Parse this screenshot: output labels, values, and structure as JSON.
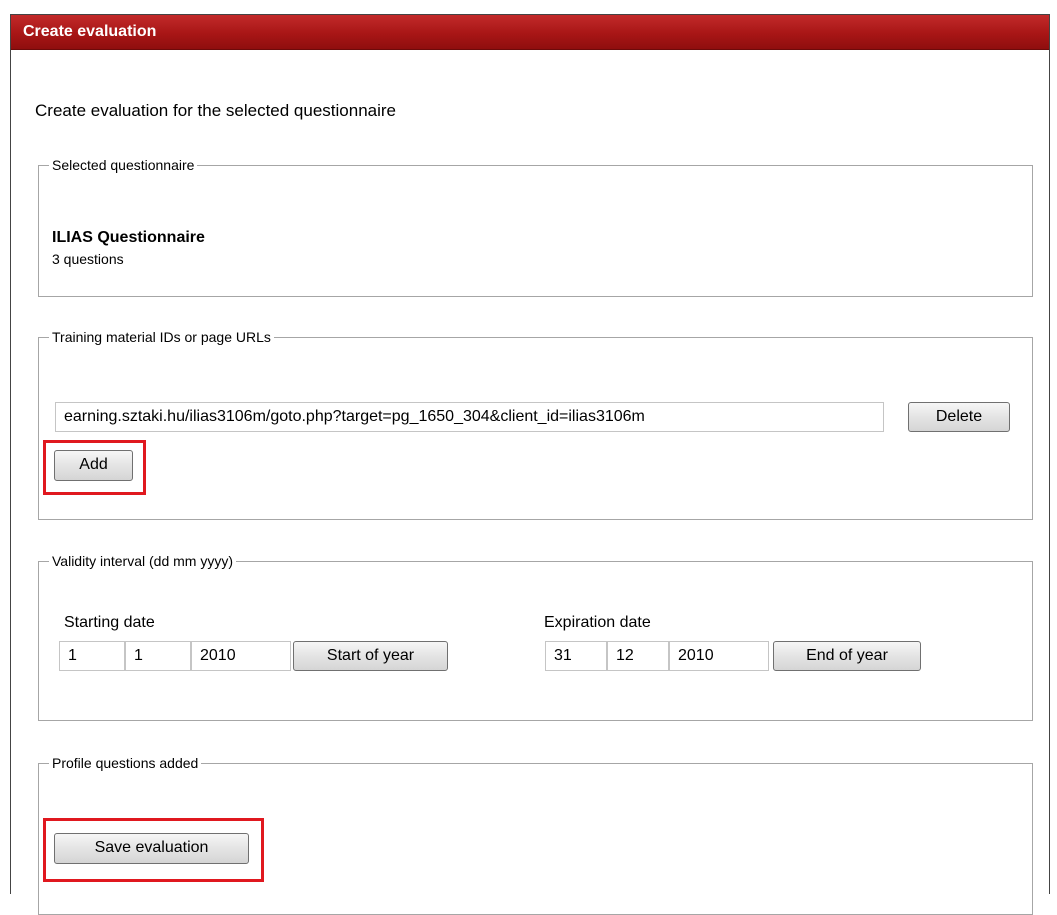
{
  "panel": {
    "title": "Create evaluation"
  },
  "intro_text": "Create evaluation for the selected questionnaire",
  "questionnaire": {
    "legend": "Selected questionnaire",
    "name": "ILIAS Questionnaire",
    "count": "3 questions"
  },
  "materials": {
    "legend": "Training material IDs or page URLs",
    "url_value": "earning.sztaki.hu/ilias3106m/goto.php?target=pg_1650_304&client_id=ilias3106m",
    "delete_label": "Delete",
    "add_label": "Add"
  },
  "validity": {
    "legend": "Validity interval (dd mm yyyy)",
    "start_label": "Starting date",
    "start_day": "1",
    "start_month": "1",
    "start_year": "2010",
    "start_button": "Start of year",
    "expire_label": "Expiration date",
    "end_day": "31",
    "end_month": "12",
    "end_year": "2010",
    "end_button": "End of year"
  },
  "profile": {
    "legend": "Profile questions added",
    "save_label": "Save evaluation"
  },
  "colors": {
    "titlebar": "#a81616",
    "highlight": "#e0181f"
  }
}
